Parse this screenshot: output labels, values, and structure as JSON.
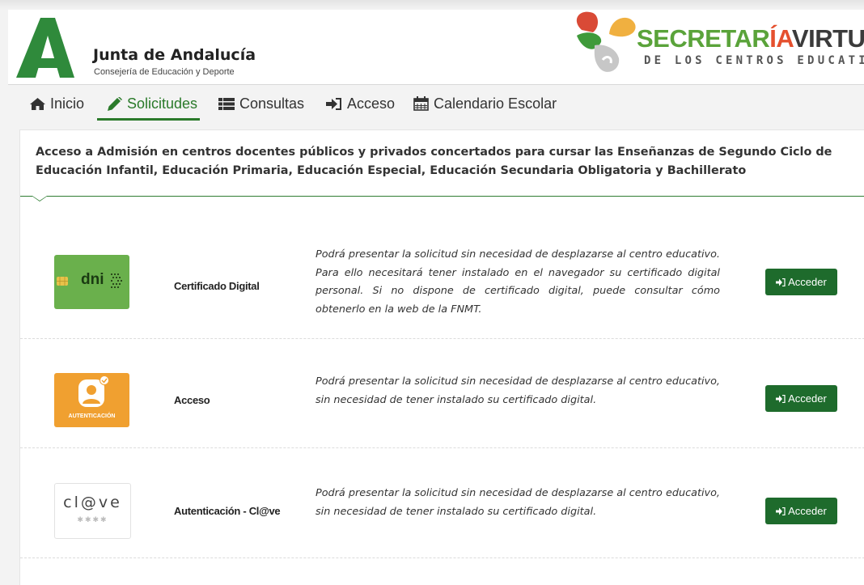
{
  "header": {
    "brand_title": "Junta de Andalucía",
    "brand_subtitle": "Consejería de Educación y Deporte",
    "sv_title_part1": "SECRETAR",
    "sv_title_accent": "ÍA",
    "sv_title_part2": "VIRTUA",
    "sv_subtitle": "DE LOS CENTROS EDUCATIVO"
  },
  "nav": {
    "items": [
      {
        "label": "Inicio",
        "icon": "home-icon"
      },
      {
        "label": "Solicitudes",
        "icon": "pencil-icon",
        "active": true
      },
      {
        "label": "Consultas",
        "icon": "list-icon"
      },
      {
        "label": "Acceso",
        "icon": "sign-in-icon"
      },
      {
        "label": "Calendario Escolar",
        "icon": "calendar-icon"
      }
    ]
  },
  "main": {
    "title": "Acceso a Admisión en centros docentes públicos y privados concertados para cursar las Enseñanzas de Segundo Ciclo de Educación Infantil, Educación Primaria, Educación Especial, Educación Secundaria Obligatoria y Bachillerato",
    "options": [
      {
        "label": "Certificado Digital",
        "icon": "dni-card-icon",
        "icon_text": "dni",
        "description": "Podrá presentar la solicitud sin necesidad de desplazarse al centro educativo. Para ello necesitará tener instalado en el navegador su certificado digital personal. Si no dispone de certificado digital, puede consultar cómo obtenerlo en la web de la FNMT.",
        "button": "Acceder"
      },
      {
        "label": "Acceso",
        "icon": "user-auth-icon",
        "icon_text": "AUTENTICACIÓN",
        "description": "Podrá presentar la solicitud sin necesidad de desplazarse al centro educativo, sin necesidad de tener instalado su certificado digital.",
        "button": "Acceder"
      },
      {
        "label": "Autenticación - Cl@ve",
        "icon": "clave-icon",
        "icon_text": "cl@ve",
        "description": "Podrá presentar la solicitud sin necesidad de desplazarse al centro educativo, sin necesidad de tener instalado su certificado digital.",
        "button": "Acceder"
      }
    ]
  },
  "colors": {
    "primary_green": "#1e6b2c",
    "nav_active": "#2a7a2a",
    "dni_green": "#6ab04c",
    "auth_orange": "#f0a030"
  }
}
